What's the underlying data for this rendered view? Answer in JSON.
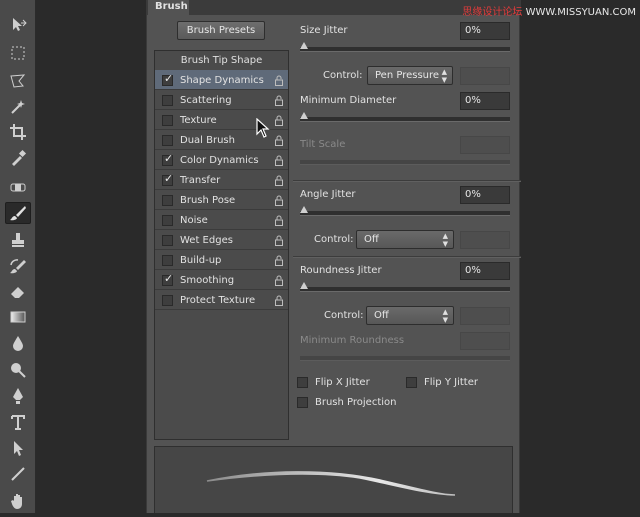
{
  "panel": {
    "tab": "Brush",
    "presets_button": "Brush Presets"
  },
  "list": {
    "header": "Brush Tip Shape",
    "items": [
      {
        "label": "Shape Dynamics",
        "checked": true,
        "selected": true,
        "lock": true
      },
      {
        "label": "Scattering",
        "checked": false,
        "lock": true
      },
      {
        "label": "Texture",
        "checked": false,
        "lock": true
      },
      {
        "label": "Dual Brush",
        "checked": false,
        "lock": true
      },
      {
        "label": "Color Dynamics",
        "checked": true,
        "lock": true
      },
      {
        "label": "Transfer",
        "checked": true,
        "lock": true
      },
      {
        "label": "Brush Pose",
        "checked": false,
        "lock": true
      },
      {
        "label": "Noise",
        "checked": false,
        "lock": true
      },
      {
        "label": "Wet Edges",
        "checked": false,
        "lock": true
      },
      {
        "label": "Build-up",
        "checked": false,
        "lock": true
      },
      {
        "label": "Smoothing",
        "checked": true,
        "lock": true
      },
      {
        "label": "Protect Texture",
        "checked": false,
        "lock": true
      }
    ]
  },
  "settings": {
    "size_jitter": {
      "label": "Size Jitter",
      "value": "0%"
    },
    "size_control": {
      "label": "Control:",
      "value": "Pen Pressure"
    },
    "minimum_diameter": {
      "label": "Minimum Diameter",
      "value": "0%"
    },
    "tilt_scale": {
      "label": "Tilt Scale"
    },
    "angle_jitter": {
      "label": "Angle Jitter",
      "value": "0%"
    },
    "angle_control": {
      "label": "Control:",
      "value": "Off"
    },
    "roundness_jitter": {
      "label": "Roundness Jitter",
      "value": "0%"
    },
    "roundness_control": {
      "label": "Control:",
      "value": "Off"
    },
    "minimum_roundness": {
      "label": "Minimum Roundness"
    },
    "flip_x": "Flip X Jitter",
    "flip_y": "Flip Y Jitter",
    "brush_projection": "Brush Projection"
  },
  "watermark": {
    "prefix": "思缘设计论坛",
    "site": "WWW.MISSYUAN.COM"
  },
  "colors": {
    "panel": "#535353",
    "selected_row": "#5f6a79",
    "toolbar": "#4a4a4a"
  }
}
